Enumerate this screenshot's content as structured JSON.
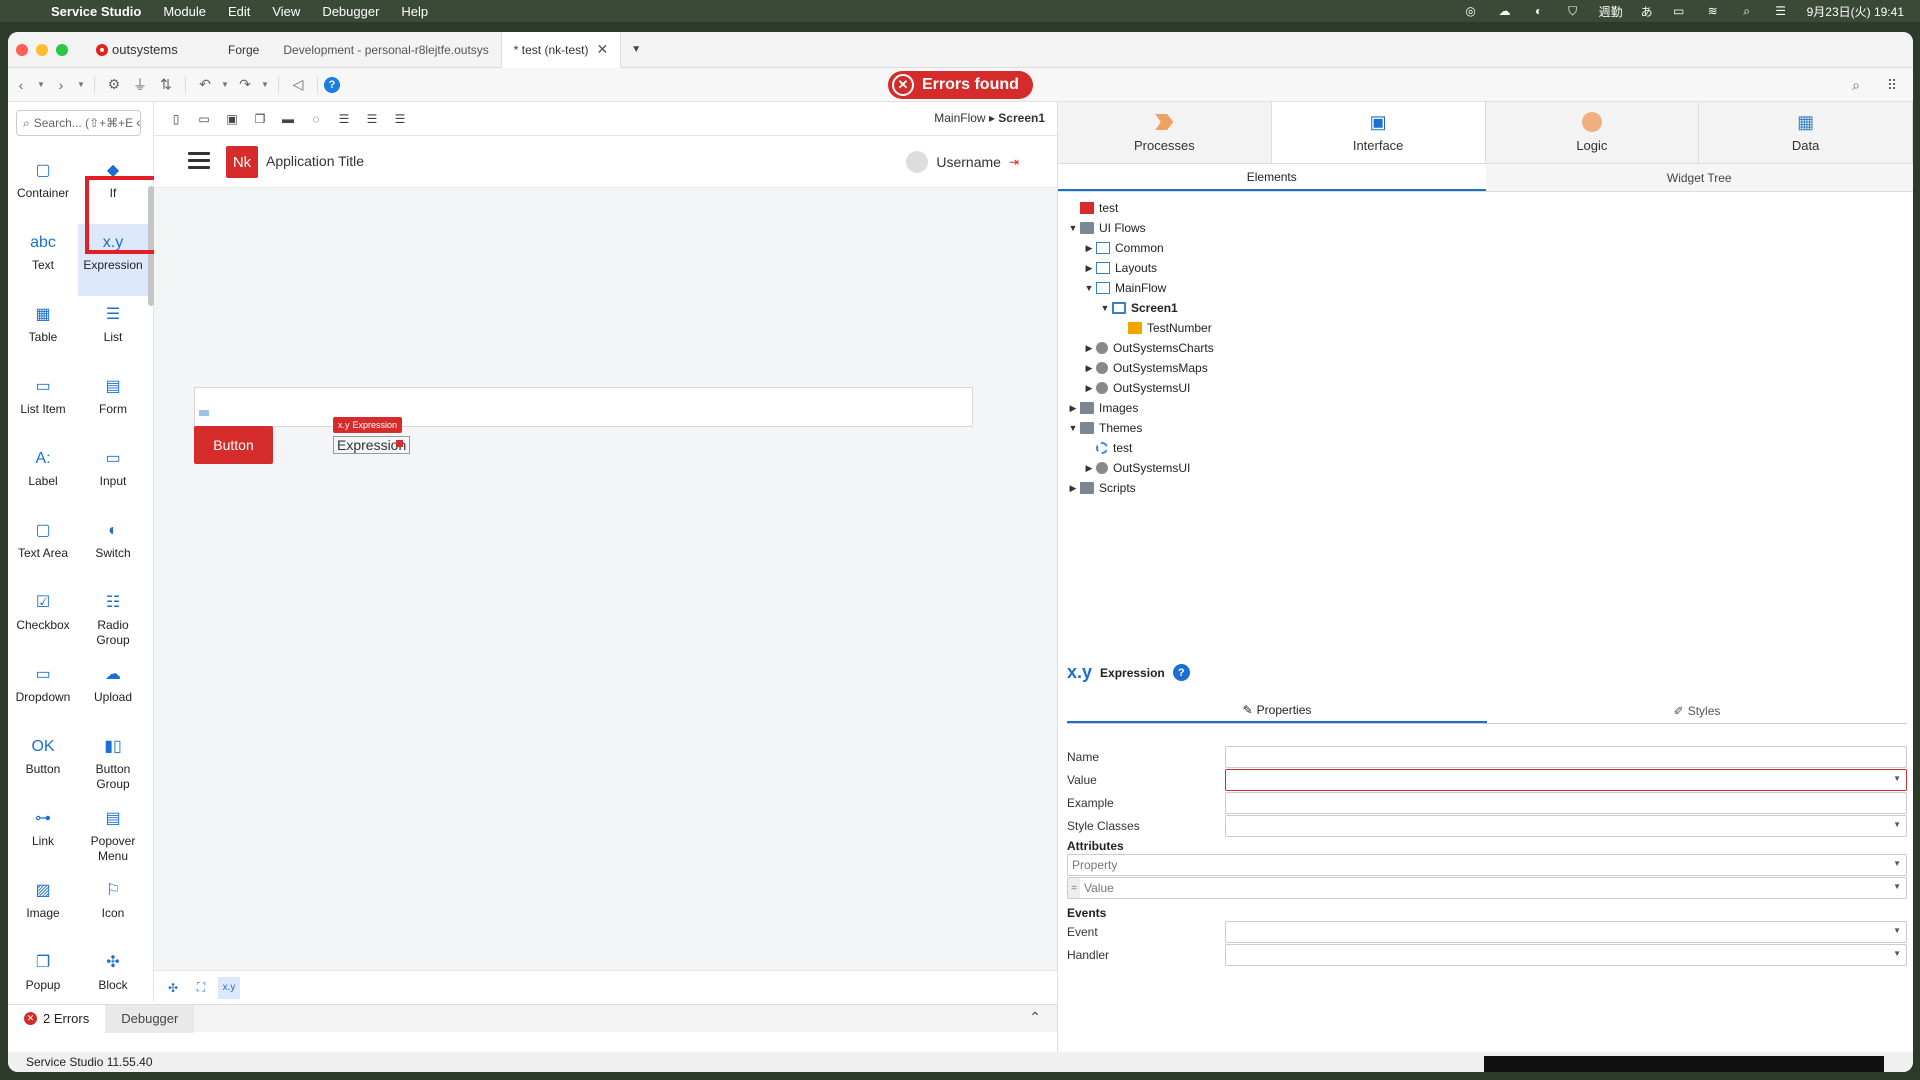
{
  "menubar": {
    "app_name": "Service Studio",
    "items": [
      "Module",
      "Edit",
      "View",
      "Debugger",
      "Help"
    ],
    "status_ime": "週勤",
    "status_kana": "あ",
    "datetime": "9月23日(火) 19:41"
  },
  "tabs": {
    "brand": "outsystems",
    "items": [
      "Forge",
      "Development - personal-r8lejtfe.outsys"
    ],
    "active": "* test (nk-test)"
  },
  "toolbar": {
    "errors_label": "Errors found"
  },
  "left_panel": {
    "search_placeholder": "Search... (⇧+⌘+E",
    "widgets": [
      {
        "label": "Container",
        "icon": "container-icon",
        "glyph": "▢"
      },
      {
        "label": "If",
        "icon": "if-icon",
        "glyph": "◆"
      },
      {
        "label": "Text",
        "icon": "text-icon",
        "glyph": "abc"
      },
      {
        "label": "Expression",
        "icon": "expression-icon",
        "glyph": "x.y"
      },
      {
        "label": "Table",
        "icon": "table-icon",
        "glyph": "▦"
      },
      {
        "label": "List",
        "icon": "list-icon",
        "glyph": "☰"
      },
      {
        "label": "List Item",
        "icon": "list-item-icon",
        "glyph": "▭"
      },
      {
        "label": "Form",
        "icon": "form-icon",
        "glyph": "▤"
      },
      {
        "label": "Label",
        "icon": "label-icon",
        "glyph": "A:"
      },
      {
        "label": "Input",
        "icon": "input-icon",
        "glyph": "▭"
      },
      {
        "label": "Text Area",
        "icon": "text-area-icon",
        "glyph": "▢"
      },
      {
        "label": "Switch",
        "icon": "switch-icon",
        "glyph": "◐"
      },
      {
        "label": "Checkbox",
        "icon": "checkbox-icon",
        "glyph": "☑"
      },
      {
        "label": "Radio\nGroup",
        "icon": "radio-group-icon",
        "glyph": "☷"
      },
      {
        "label": "Dropdown",
        "icon": "dropdown-icon",
        "glyph": "▭"
      },
      {
        "label": "Upload",
        "icon": "upload-icon",
        "glyph": "☁"
      },
      {
        "label": "Button",
        "icon": "button-icon",
        "glyph": "OK"
      },
      {
        "label": "Button\nGroup",
        "icon": "button-group-icon",
        "glyph": "▮▯"
      },
      {
        "label": "Link",
        "icon": "link-icon",
        "glyph": "⊶"
      },
      {
        "label": "Popover\nMenu",
        "icon": "popover-menu-icon",
        "glyph": "▤"
      },
      {
        "label": "Image",
        "icon": "image-icon",
        "glyph": "▨"
      },
      {
        "label": "Icon",
        "icon": "flag-icon",
        "glyph": "⚐"
      },
      {
        "label": "Popup",
        "icon": "popup-icon",
        "glyph": "❐"
      },
      {
        "label": "Block",
        "icon": "block-icon",
        "glyph": "✣"
      }
    ]
  },
  "canvas": {
    "breadcrumb_flow": "MainFlow",
    "breadcrumb_screen": "Screen1",
    "app_badge": "Nk",
    "app_title": "Application Title",
    "username": "Username",
    "button_label": "Button",
    "expr_tag": "Expression",
    "expr_tag_prefix": "x.y",
    "expr_text": "Expression",
    "bottom_selected": "x.y"
  },
  "errors_bar": {
    "errors_label": "2 Errors",
    "debugger_label": "Debugger",
    "version": "Service Studio 11.55.40"
  },
  "right_panel": {
    "nav": [
      "Processes",
      "Interface",
      "Logic",
      "Data"
    ],
    "subtabs": [
      "Elements",
      "Widget Tree"
    ],
    "tree": [
      {
        "label": "test",
        "icon": "i-nk",
        "level": 0,
        "arrow": ""
      },
      {
        "label": "UI Flows",
        "icon": "i-folder",
        "level": 0,
        "arrow": "▼"
      },
      {
        "label": "Common",
        "icon": "i-flow",
        "level": 1,
        "arrow": "▶"
      },
      {
        "label": "Layouts",
        "icon": "i-flow",
        "level": 1,
        "arrow": "▶"
      },
      {
        "label": "MainFlow",
        "icon": "i-flow",
        "level": 1,
        "arrow": "▼"
      },
      {
        "label": "Screen1",
        "icon": "i-screen",
        "level": 2,
        "arrow": "▼",
        "bold": true
      },
      {
        "label": "TestNumber",
        "icon": "i-var",
        "level": 3,
        "arrow": ""
      },
      {
        "label": "OutSystemsCharts",
        "icon": "i-mod",
        "level": 1,
        "arrow": "▶"
      },
      {
        "label": "OutSystemsMaps",
        "icon": "i-mod",
        "level": 1,
        "arrow": "▶"
      },
      {
        "label": "OutSystemsUI",
        "icon": "i-mod",
        "level": 1,
        "arrow": "▶"
      },
      {
        "label": "Images",
        "icon": "i-folder",
        "level": 0,
        "arrow": "▶"
      },
      {
        "label": "Themes",
        "icon": "i-folder",
        "level": 0,
        "arrow": "▼"
      },
      {
        "label": "test",
        "icon": "i-theme",
        "level": 1,
        "arrow": ""
      },
      {
        "label": "OutSystemsUI",
        "icon": "i-mod",
        "level": 1,
        "arrow": "▶"
      },
      {
        "label": "Scripts",
        "icon": "i-folder",
        "level": 0,
        "arrow": "▶"
      }
    ],
    "props": {
      "glyph": "x.y",
      "title": "Expression",
      "tabs": [
        "Properties",
        "Styles"
      ],
      "fields": {
        "name": "Name",
        "value": "Value",
        "example": "Example",
        "style_classes": "Style Classes",
        "attributes": "Attributes",
        "attr_property_placeholder": "Property",
        "attr_value_placeholder": "Value",
        "events": "Events",
        "event": "Event",
        "handler": "Handler"
      }
    }
  }
}
